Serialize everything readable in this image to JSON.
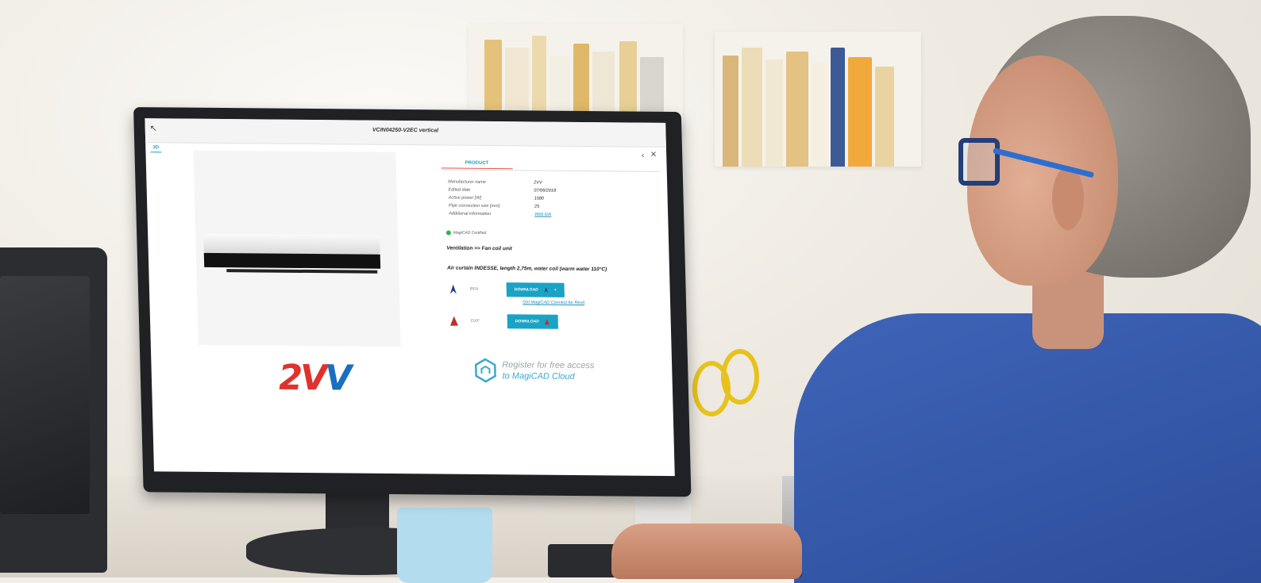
{
  "window": {
    "title": "VCIN04250-V2EC vertical"
  },
  "tabs": {
    "viewer_tab": "3D",
    "product_tab": "PRODUCT"
  },
  "properties": [
    {
      "label": "Manufacturer name",
      "value": "2VV"
    },
    {
      "label": "Edited date",
      "value": "07/06/2018"
    },
    {
      "label": "Active power [W]",
      "value": "1580"
    },
    {
      "label": "Pipe connection size [mm]",
      "value": "25"
    },
    {
      "label": "Additional information",
      "value": "Web link"
    }
  ],
  "certified_label": "MagiCAD Certified",
  "category": "Ventilation >> Fan coil unit",
  "product_description": "Air curtain INDESSE, length 2,75m, water coil (warm water 110°C)",
  "downloads": [
    {
      "format": "RFA",
      "button": "DOWNLOAD",
      "icon": "revit-icon"
    },
    {
      "format": "DXF",
      "button": "DOWNLOAD",
      "icon": "autocad-icon"
    }
  ],
  "revit_link": "Get MagiCAD Connect for Revit",
  "brand_logo": {
    "text_part1": "2V",
    "text_part2": "V"
  },
  "register": {
    "line1": "Register for free access",
    "line2": "to MagiCAD Cloud"
  },
  "colors": {
    "accent": "#1aa3c4",
    "brand_red": "#e0322d",
    "brand_blue": "#1a6fc1",
    "certified_green": "#36b24a"
  }
}
